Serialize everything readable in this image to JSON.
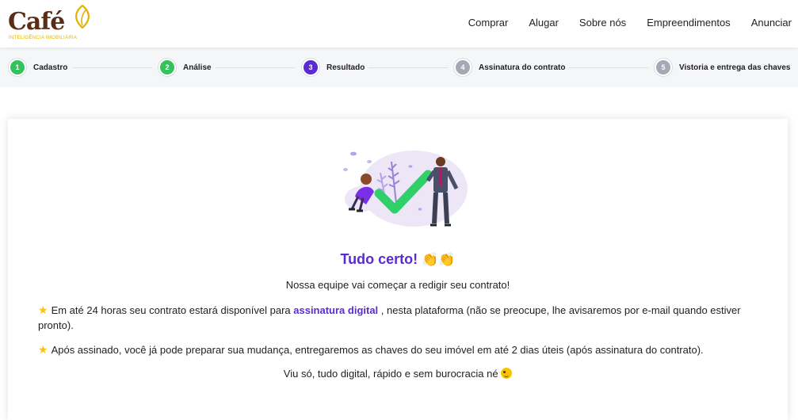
{
  "brand": {
    "name": "Café",
    "tagline": "INTELIGÊNCIA IMOBILIÁRIA",
    "primary_color": "#5a2d16",
    "accent_color": "#e1b400"
  },
  "nav": {
    "items": [
      "Comprar",
      "Alugar",
      "Sobre nós",
      "Empreendimentos",
      "Anunciar"
    ]
  },
  "steps": [
    {
      "number": "1",
      "label": "Cadastro",
      "status": "done",
      "color": "#36c25b"
    },
    {
      "number": "2",
      "label": "Análise",
      "status": "done",
      "color": "#36c25b"
    },
    {
      "number": "3",
      "label": "Resultado",
      "status": "current",
      "color": "#5b2ad0"
    },
    {
      "number": "4",
      "label": "Assinatura do contrato",
      "status": "pending",
      "color": "#a4a9b5"
    },
    {
      "number": "5",
      "label": "Vistoria e entrega das chaves",
      "status": "pending",
      "color": "#a4a9b5"
    }
  ],
  "result": {
    "illustration_icon": "approval-checkmark-illustration",
    "title": "Tudo certo!",
    "title_emoji": "👏👏",
    "subtitle": "Nossa equipe vai começar a redigir seu contrato!",
    "p1_before": "Em até 24 horas seu contrato estará disponível para ",
    "p1_link": "assinatura digital",
    "p1_after": " , nesta plataforma (não se preocupe, lhe avisaremos por e-mail quando estiver pronto).",
    "p2": "Após assinado, você já pode preparar sua mudança, entregaremos as chaves do seu imóvel em até 2 dias úteis (após assinatura do contrato).",
    "closing": "Viu só, tudo digital, rápido e sem burocracia né",
    "star_icon": "star-icon",
    "wink_icon": "winking-face-icon"
  }
}
